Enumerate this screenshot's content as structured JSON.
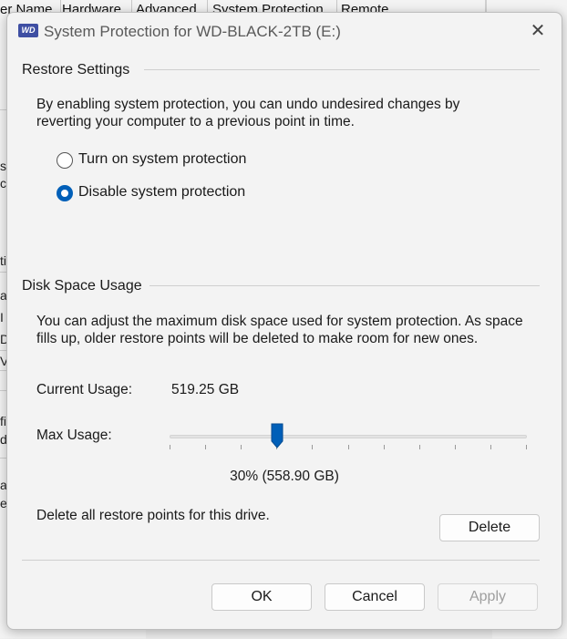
{
  "background_window": {
    "tabs": [
      "er Name",
      "Hardware",
      "Advanced",
      "System Protection",
      "Remote"
    ],
    "left_fragments": [
      "sa",
      "co",
      "ti",
      "ai",
      "I",
      "D",
      "V",
      "fi",
      "do",
      "at",
      "e"
    ]
  },
  "dialog": {
    "icon_text": "WD",
    "title": "System Protection for WD-BLACK-2TB (E:)",
    "close_glyph": "✕"
  },
  "restore_settings": {
    "header": "Restore Settings",
    "description_line1": "By enabling system protection, you can undo undesired changes by",
    "description_line2": "reverting your computer to a previous point in time.",
    "options": [
      {
        "label": "Turn on system protection",
        "checked": false
      },
      {
        "label": "Disable system protection",
        "checked": true
      }
    ]
  },
  "disk_space": {
    "header": "Disk Space Usage",
    "description_line1": "You can adjust the maximum disk space used for system protection. As space",
    "description_line2": "fills up, older restore points will be deleted to make room for new ones.",
    "current_usage_label": "Current Usage:",
    "current_usage_value": "519.25 GB",
    "max_usage_label": "Max Usage:",
    "max_usage_fraction": 0.3,
    "max_usage_display": "30% (558.90 GB)",
    "delete_text": "Delete all restore points for this drive.",
    "delete_button": "Delete"
  },
  "footer": {
    "ok": "OK",
    "cancel": "Cancel",
    "apply": "Apply"
  },
  "colors": {
    "accent": "#005fb8"
  }
}
